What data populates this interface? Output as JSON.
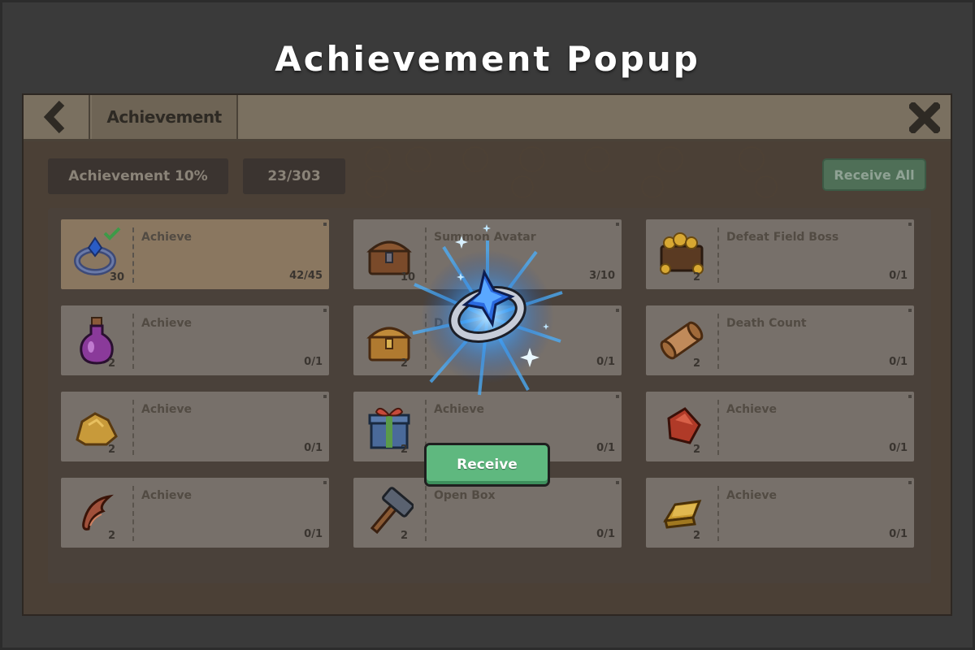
{
  "page_title": "Achievement Popup",
  "header": {
    "tab_label": "Achievement"
  },
  "summary": {
    "percent_label": "Achievement 10%",
    "count_label": "23/303",
    "receive_all_label": "Receive All"
  },
  "cards": [
    {
      "name": "Achieve",
      "count": "30",
      "progress": "42/45",
      "icon": "ring-icon",
      "highlight": true,
      "completed": true
    },
    {
      "name": "Summon Avatar",
      "count": "10",
      "progress": "3/10",
      "icon": "treasure-chest-icon"
    },
    {
      "name": "Defeat Field Boss",
      "count": "2",
      "progress": "0/1",
      "icon": "gold-pile-icon"
    },
    {
      "name": "Achieve",
      "count": "2",
      "progress": "0/1",
      "icon": "potion-icon"
    },
    {
      "name": "D",
      "count": "2",
      "progress": "0/1",
      "icon": "golden-chest-icon"
    },
    {
      "name": "Death Count",
      "count": "2",
      "progress": "0/1",
      "icon": "scroll-icon"
    },
    {
      "name": "Achieve",
      "count": "2",
      "progress": "0/1",
      "icon": "gold-ore-icon"
    },
    {
      "name": "Achieve",
      "count": "2",
      "progress": "0/1",
      "icon": "gift-box-icon"
    },
    {
      "name": "Achieve",
      "count": "2",
      "progress": "0/1",
      "icon": "red-gem-icon"
    },
    {
      "name": "Achieve",
      "count": "2",
      "progress": "0/1",
      "icon": "claw-icon"
    },
    {
      "name": "Open Box",
      "count": "2",
      "progress": "0/1",
      "icon": "hammer-icon"
    },
    {
      "name": "Achieve",
      "count": "2",
      "progress": "0/1",
      "icon": "gold-bar-icon"
    }
  ],
  "popup": {
    "reward_icon": "star-ring-icon",
    "receive_label": "Receive"
  },
  "colors": {
    "background": "#3a3a3a",
    "receive_button": "#5fb87f",
    "receive_all_button": "#4f6f57",
    "glow": "#3aa0ff"
  }
}
